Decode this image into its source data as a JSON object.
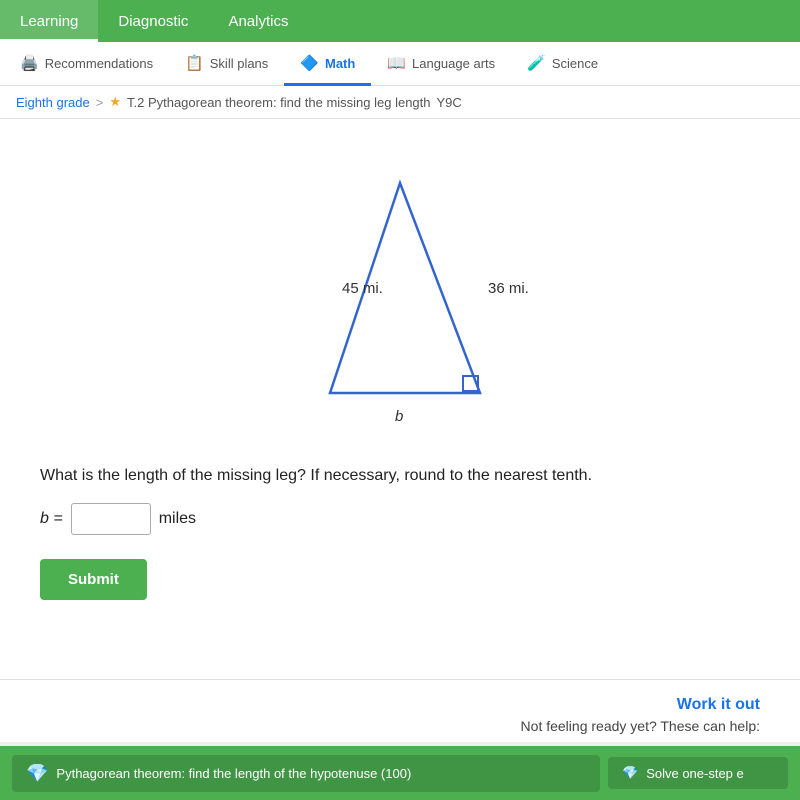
{
  "topNav": {
    "items": [
      {
        "label": "Learning",
        "active": true
      },
      {
        "label": "Diagnostic",
        "active": false
      },
      {
        "label": "Analytics",
        "active": false
      }
    ]
  },
  "subNav": {
    "tabs": [
      {
        "label": "Recommendations",
        "icon": "🖨",
        "active": false
      },
      {
        "label": "Skill plans",
        "icon": "📋",
        "active": false
      },
      {
        "label": "Math",
        "icon": "🔷",
        "active": true
      },
      {
        "label": "Language arts",
        "icon": "📖",
        "active": false
      },
      {
        "label": "Science",
        "icon": "🧪",
        "active": false
      }
    ]
  },
  "breadcrumb": {
    "grade": "Eighth grade",
    "separator": ">",
    "skill": "T.2 Pythagorean theorem: find the missing leg length",
    "code": "Y9C"
  },
  "triangle": {
    "hypotenuse": "45 mi.",
    "leg": "36 mi.",
    "missing": "b"
  },
  "question": {
    "text": "What is the length of the missing leg? If necessary, round to the nearest tenth.",
    "label": "b =",
    "unit": "miles",
    "placeholder": ""
  },
  "submitButton": {
    "label": "Submit"
  },
  "workItOut": {
    "title": "Work it out",
    "text": "Not feeling ready yet? These can help:"
  },
  "bottomBar": {
    "link1": "Pythagorean theorem: find the length of the hypotenuse (100)",
    "link2": "Solve one-step e"
  }
}
